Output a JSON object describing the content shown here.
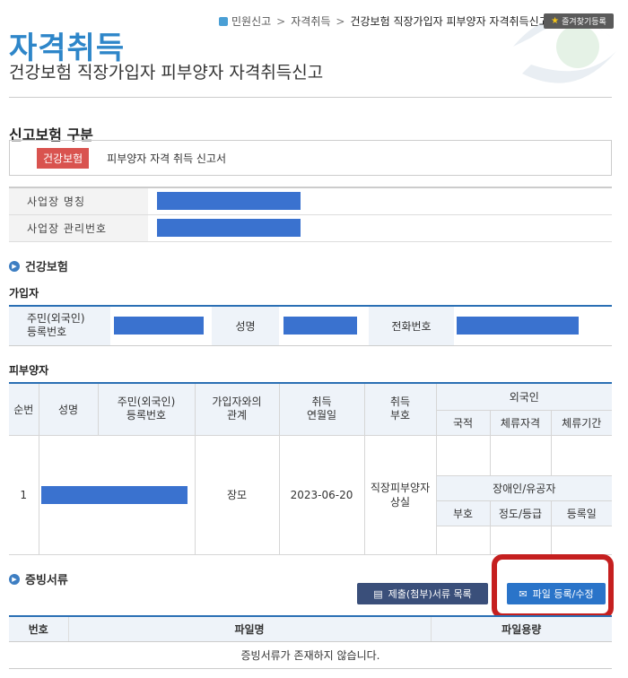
{
  "breadcrumb": [
    "민원신고",
    "자격취득",
    "건강보험 직장가입자 피부양자 자격취득신고"
  ],
  "favorite_label": "즐겨찾기등록",
  "title_main": "자격취득",
  "title_sub": "건강보험 직장가입자 피부양자 자격취득신고",
  "insurance_section": {
    "title": "신고보험 구분",
    "tag": "건강보험",
    "form_name": "피부양자 자격 취득 신고서"
  },
  "workplace": {
    "name_label": "사업장 명칭",
    "mgmt_label": "사업장 관리번호"
  },
  "health_section_title": "건강보험",
  "subscriber": {
    "title": "가입자",
    "id_label": "주민(외국인)\n등록번호",
    "name_label": "성명",
    "phone_label": "전화번호"
  },
  "dependent": {
    "title": "피부양자",
    "headers": {
      "seq": "순번",
      "name": "성명",
      "id": "주민(외국인)\n등록번호",
      "relation": "가입자와의\n관계",
      "acq_date": "취득\n연월일",
      "acq_code": "취득\n부호",
      "foreigner": "외국인",
      "nationality": "국적",
      "stay_status": "체류자격",
      "stay_period": "체류기간",
      "disabled": "장애인/유공자",
      "code": "부호",
      "grade": "정도/등급",
      "reg_date": "등록일"
    },
    "row": {
      "seq": "1",
      "relation": "장모",
      "acq_date": "2023-06-20",
      "acq_code": "직장피부양자\n상실"
    }
  },
  "evidence": {
    "title": "증빙서류",
    "list_button": "제출(첨부)서류 목록",
    "file_button": "파일 등록/수정",
    "col_no": "번호",
    "col_filename": "파일명",
    "col_size": "파일용량",
    "empty_message": "증빙서류가 존재하지 않습니다."
  },
  "colors": {
    "accent": "#2e86c9",
    "redaction": "#3a72cf",
    "tag": "#d9534f",
    "highlight": "#c51f1f"
  }
}
